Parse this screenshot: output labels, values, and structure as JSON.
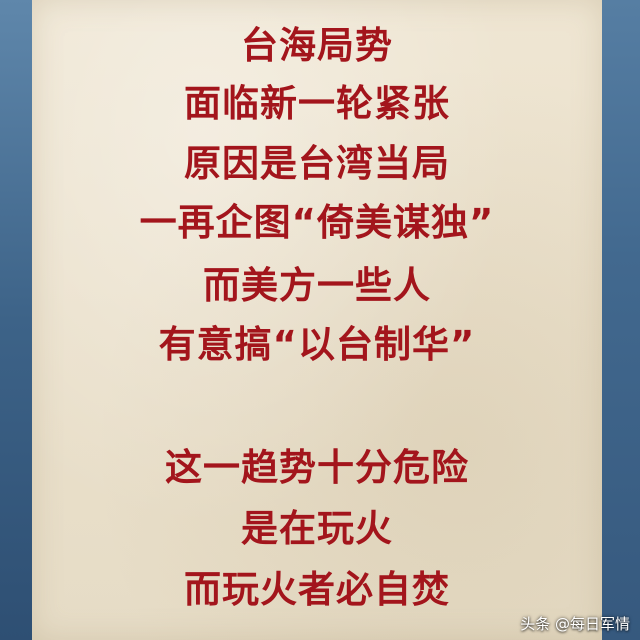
{
  "poem": {
    "stanza1": [
      "台海局势",
      "面临新一轮紧张",
      "原因是台湾当局",
      "一再企图“倚美谋独”",
      "而美方一些人",
      "有意搞“以台制华”"
    ],
    "stanza2": [
      "这一趋势十分危险",
      "是在玩火",
      "而玩火者必自焚"
    ]
  },
  "watermark": {
    "text": "头条 @每日军情"
  },
  "colors": {
    "text": "#a3151c",
    "paper": "#ece3cf",
    "background": "#3f6388"
  }
}
